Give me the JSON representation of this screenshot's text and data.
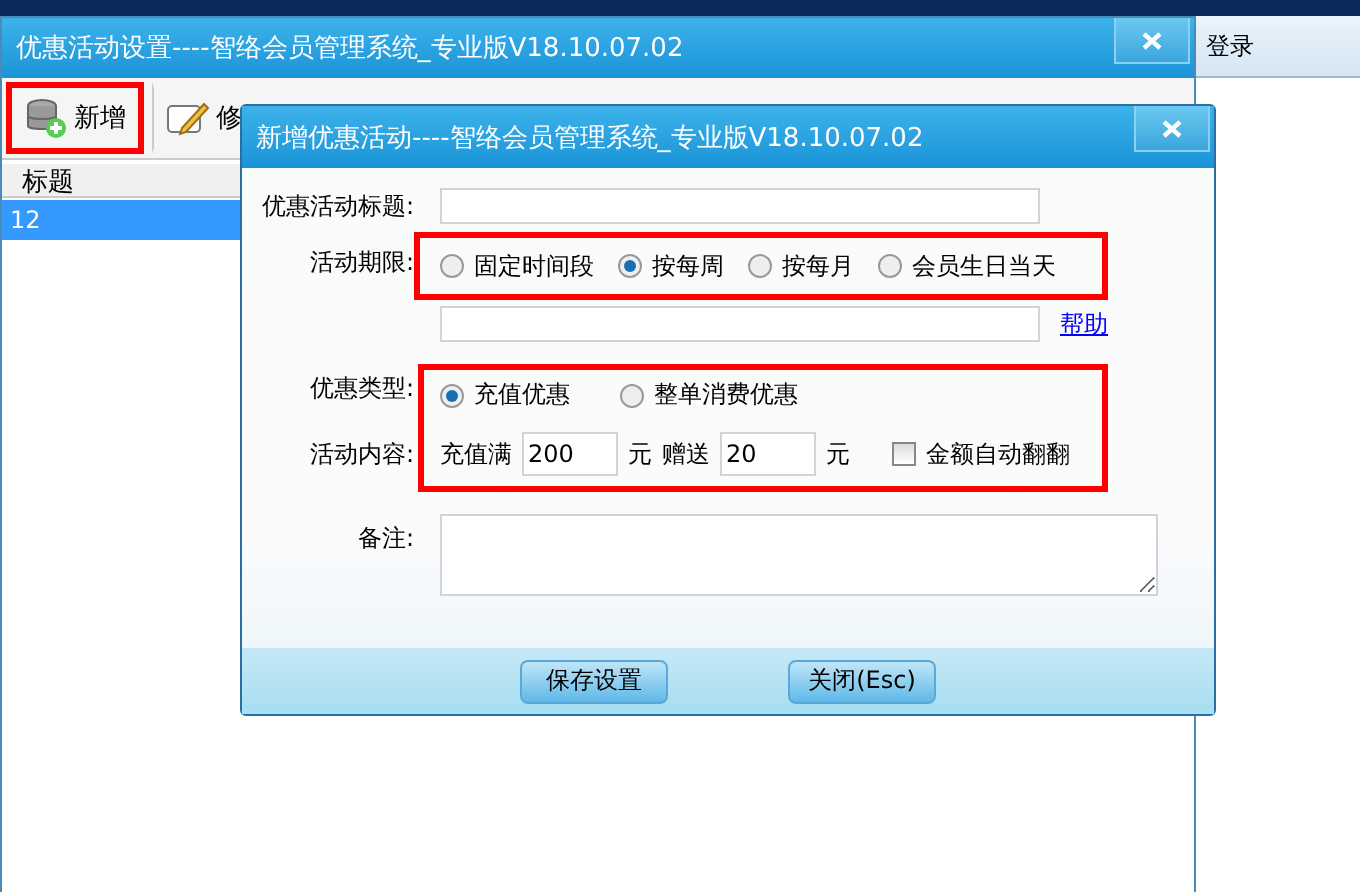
{
  "background_app": {
    "menu_text": "登录"
  },
  "main_window": {
    "title": "优惠活动设置----智络会员管理系统_专业版V18.10.07.02",
    "toolbar": [
      {
        "kind": "add",
        "label": "新增",
        "highlighted": true
      },
      {
        "kind": "edit",
        "label": "修",
        "highlighted": false
      }
    ],
    "table": {
      "columns": [
        "标题"
      ],
      "rows": [
        {
          "cells": [
            "12"
          ],
          "selected": true
        }
      ]
    }
  },
  "dialog": {
    "title": "新增优惠活动----智络会员管理系统_专业版V18.10.07.02",
    "title_field": {
      "label": "优惠活动标题:"
    },
    "period": {
      "label": "活动期限:",
      "highlighted": true,
      "options": [
        {
          "label": "固定时间段",
          "selected": false
        },
        {
          "label": "按每周",
          "selected": true
        },
        {
          "label": "按每月",
          "selected": false
        },
        {
          "label": "会员生日当天",
          "selected": false
        }
      ]
    },
    "help_link": "帮助",
    "discount": {
      "highlighted": true,
      "type": {
        "label": "优惠类型:",
        "options": [
          {
            "label": "充值优惠",
            "selected": true
          },
          {
            "label": "整单消费优惠",
            "selected": false
          }
        ]
      },
      "content": {
        "label": "活动内容:",
        "recharge_label": "充值满",
        "recharge_value": "200",
        "unit_1": "元",
        "bonus_label": "赠送",
        "bonus_value": "20",
        "unit_2": "元",
        "auto_checkbox": {
          "label": "金额自动翻翻",
          "checked": false
        }
      }
    },
    "note": {
      "label": "备注:"
    },
    "buttons": [
      {
        "label": "保存设置"
      },
      {
        "label": "关闭(Esc)"
      }
    ]
  }
}
